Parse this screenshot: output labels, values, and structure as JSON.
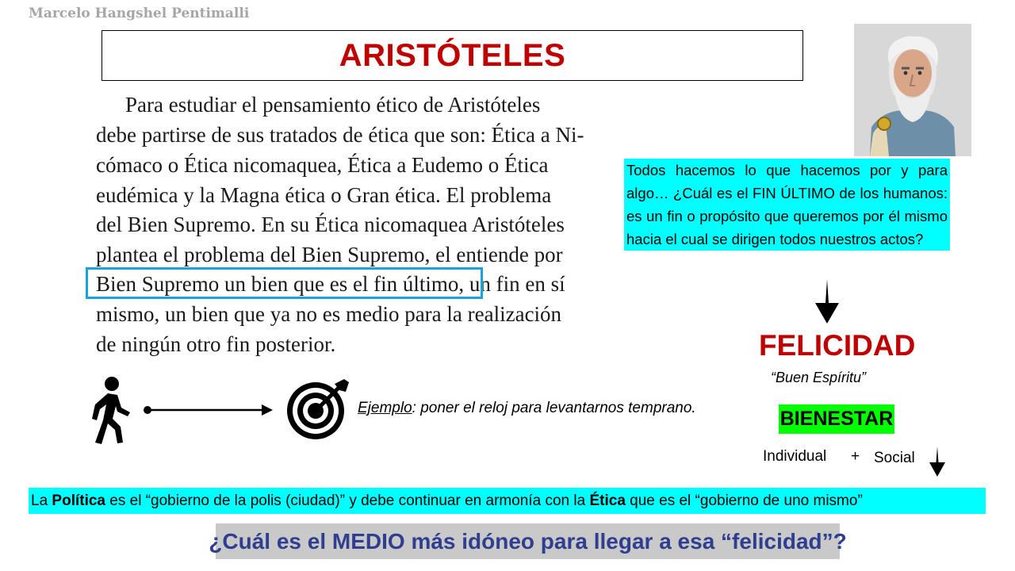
{
  "author": "Marcelo Hangshel Pentimalli",
  "title": "ARISTÓTELES",
  "scanned_text": {
    "line1": "Para estudiar el pensamiento ético de Aristóteles",
    "line2": "debe partirse de sus tratados de ética que son: Ética a Ni-",
    "line3": "cómaco o Ética nicomaquea, Ética a Eudemo o Ética",
    "line4": "eudémica y la Magna ética o Gran ética. El problema",
    "line5": "del Bien Supremo. En su Ética nicomaquea Aristóteles",
    "line6": "plantea el problema del Bien Supremo, el entiende por",
    "line7": "Bien Supremo un bien que es el fin último, un fin en sí",
    "line8": "mismo, un bien que ya no es medio para la realización",
    "line9": "de ningún otro fin posterior."
  },
  "question": "Todos hacemos lo que hacemos por y para algo… ¿Cuál es el FIN ÚLTIMO de los humanos: es un fin o propósito que queremos por él mismo hacia el cual se dirigen todos nuestros actos?",
  "felicidad": "FELICIDAD",
  "buen_espiritu": "“Buen Espíritu”",
  "bienestar": "BIENESTAR",
  "individual": "Individual",
  "plus": "+",
  "social": "Social",
  "example": {
    "label": "Ejemplo",
    "text": ": poner el reloj para levantarnos temprano."
  },
  "politica": {
    "p1": "La ",
    "b1": "Política",
    "p2": " es el “gobierno de la polis (ciudad)” y debe continuar en armonía con la ",
    "b2": "Ética",
    "p3": " que es el “gobierno de uno mismo”"
  },
  "medio_question": "¿Cuál es el MEDIO más idóneo para llegar a esa “felicidad”?",
  "colors": {
    "title_red": "#c00000",
    "cyan_highlight": "#00ffff",
    "green_highlight": "#00ff00",
    "blue_box": "#1aa3db",
    "question_blue": "#2f3e8f"
  }
}
